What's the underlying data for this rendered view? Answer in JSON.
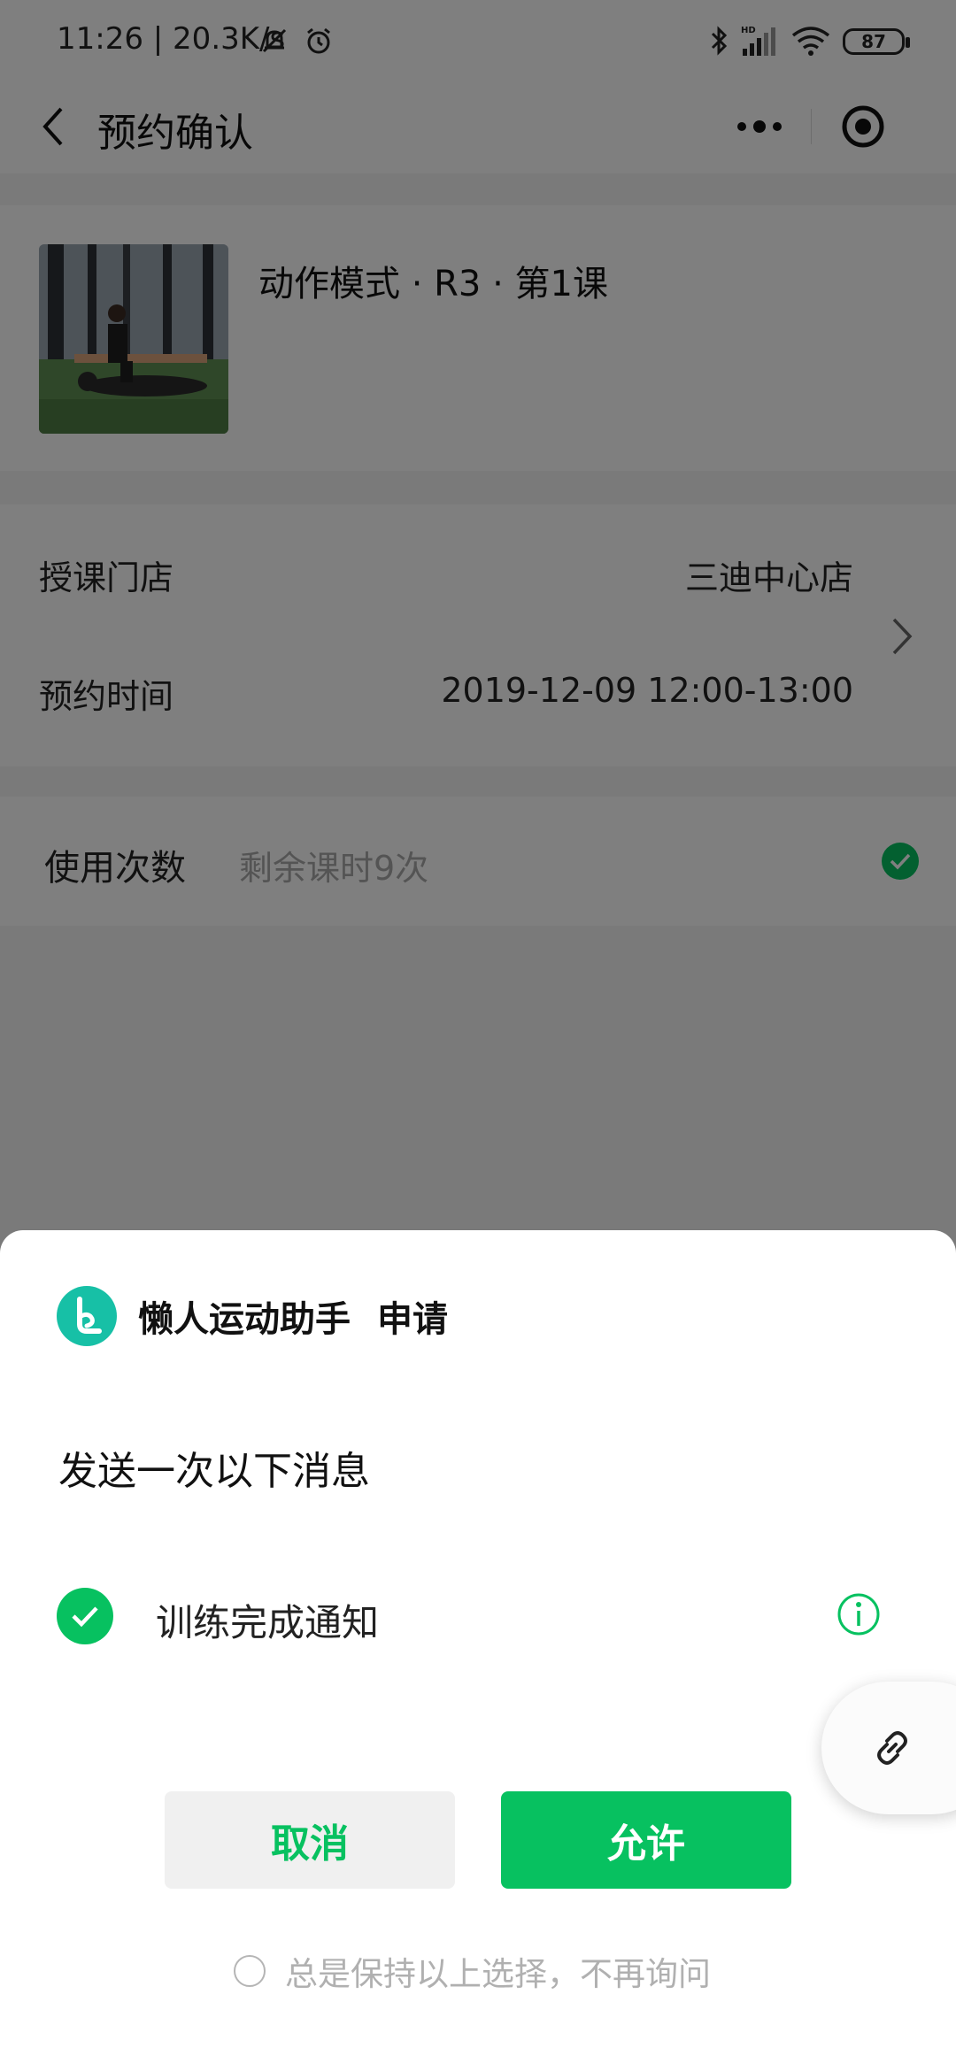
{
  "status_bar": {
    "time_speed": "11:26 | 20.3K/s",
    "battery": "87",
    "icons": [
      "mute-bell-icon",
      "alarm-icon",
      "bluetooth-icon",
      "hd-signal-icon",
      "wifi-icon",
      "battery-icon"
    ]
  },
  "nav": {
    "title": "预约确认",
    "back_icon": "chevron-left-icon",
    "more_icon": "more-dots-icon",
    "close_icon": "target-close-icon"
  },
  "course": {
    "title": "动作模式 · R3 · 第1课"
  },
  "booking": {
    "store_label": "授课门店",
    "store_value": "三迪中心店",
    "time_label": "预约时间",
    "time_value": "2019-12-09 12:00-13:00"
  },
  "usage": {
    "label": "使用次数",
    "value": "剩余课时9次",
    "checked": true
  },
  "sheet": {
    "app_name": "懒人运动助手",
    "request_word": "申请",
    "subtitle": "发送一次以下消息",
    "permission_label": "训练完成通知",
    "permission_checked": true,
    "cancel_label": "取消",
    "allow_label": "允许",
    "always_label": "总是保持以上选择，不再询问"
  },
  "colors": {
    "brand_green": "#07c160",
    "app_logo": "#17c0a6",
    "overlay": "rgba(0,0,0,0.5)"
  }
}
